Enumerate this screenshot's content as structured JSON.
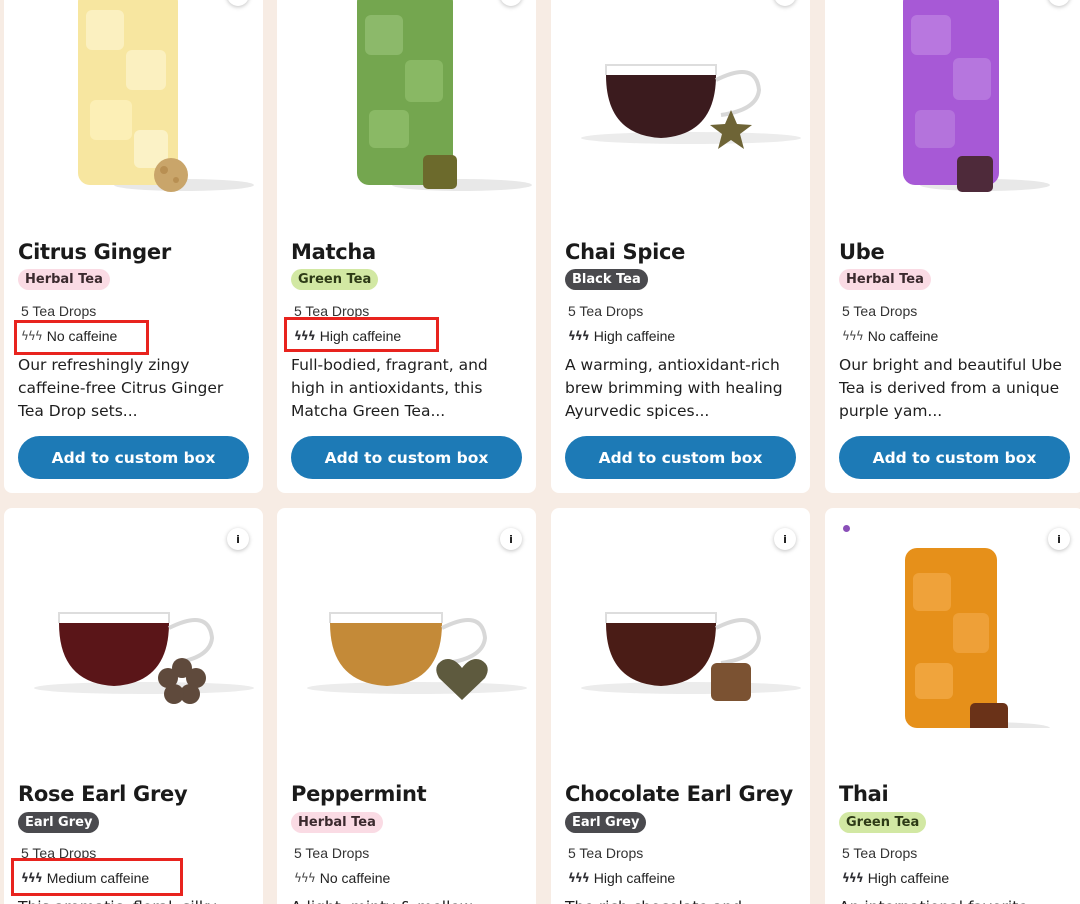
{
  "products": [
    {
      "name": "Citrus Ginger",
      "category": "Herbal Tea",
      "drops": "5 Tea Drops",
      "caffeine": "No caffeine",
      "bolts": "none",
      "description": "Our refreshingly zingy caffeine-free Citrus Ginger Tea Drop sets...",
      "button": "Add to custom box"
    },
    {
      "name": "Matcha",
      "category": "Green Tea",
      "drops": "5 Tea Drops",
      "caffeine": "High caffeine",
      "bolts": "three",
      "description": "Full-bodied, fragrant, and high in antioxidants, this Matcha Green Tea...",
      "button": "Add to custom box"
    },
    {
      "name": "Chai Spice",
      "category": "Black Tea",
      "drops": "5 Tea Drops",
      "caffeine": "High caffeine",
      "bolts": "three",
      "description": "A warming, antioxidant-rich brew brimming with healing Ayurvedic spices...",
      "button": "Add to custom box"
    },
    {
      "name": "Ube",
      "category": "Herbal Tea",
      "drops": "5 Tea Drops",
      "caffeine": "No caffeine",
      "bolts": "none",
      "description": "Our bright and beautiful Ube Tea is derived from a unique purple yam...",
      "button": "Add to custom box"
    },
    {
      "name": "Rose Earl Grey",
      "category": "Earl Grey",
      "drops": "5 Tea Drops",
      "caffeine": "Medium caffeine",
      "bolts": "two",
      "description": "This aromatic, floral, silky..."
    },
    {
      "name": "Peppermint",
      "category": "Herbal Tea",
      "drops": "5 Tea Drops",
      "caffeine": "No caffeine",
      "bolts": "none",
      "description": "A light, minty & mellow herbal..."
    },
    {
      "name": "Chocolate Earl Grey",
      "category": "Earl Grey",
      "drops": "5 Tea Drops",
      "caffeine": "High caffeine",
      "bolts": "three",
      "description": "The rich chocolate and natural..."
    },
    {
      "name": "Thai",
      "category": "Green Tea",
      "drops": "5 Tea Drops",
      "caffeine": "High caffeine",
      "bolts": "three",
      "description": "An international favorite..."
    }
  ],
  "info_label": "i",
  "colors": {
    "button": "#1d7ab6",
    "highlight": "#e8231e",
    "background": "#f7ece4"
  },
  "icons": {
    "info": "info-icon",
    "caffeine": "lightning-bolt-icon"
  }
}
